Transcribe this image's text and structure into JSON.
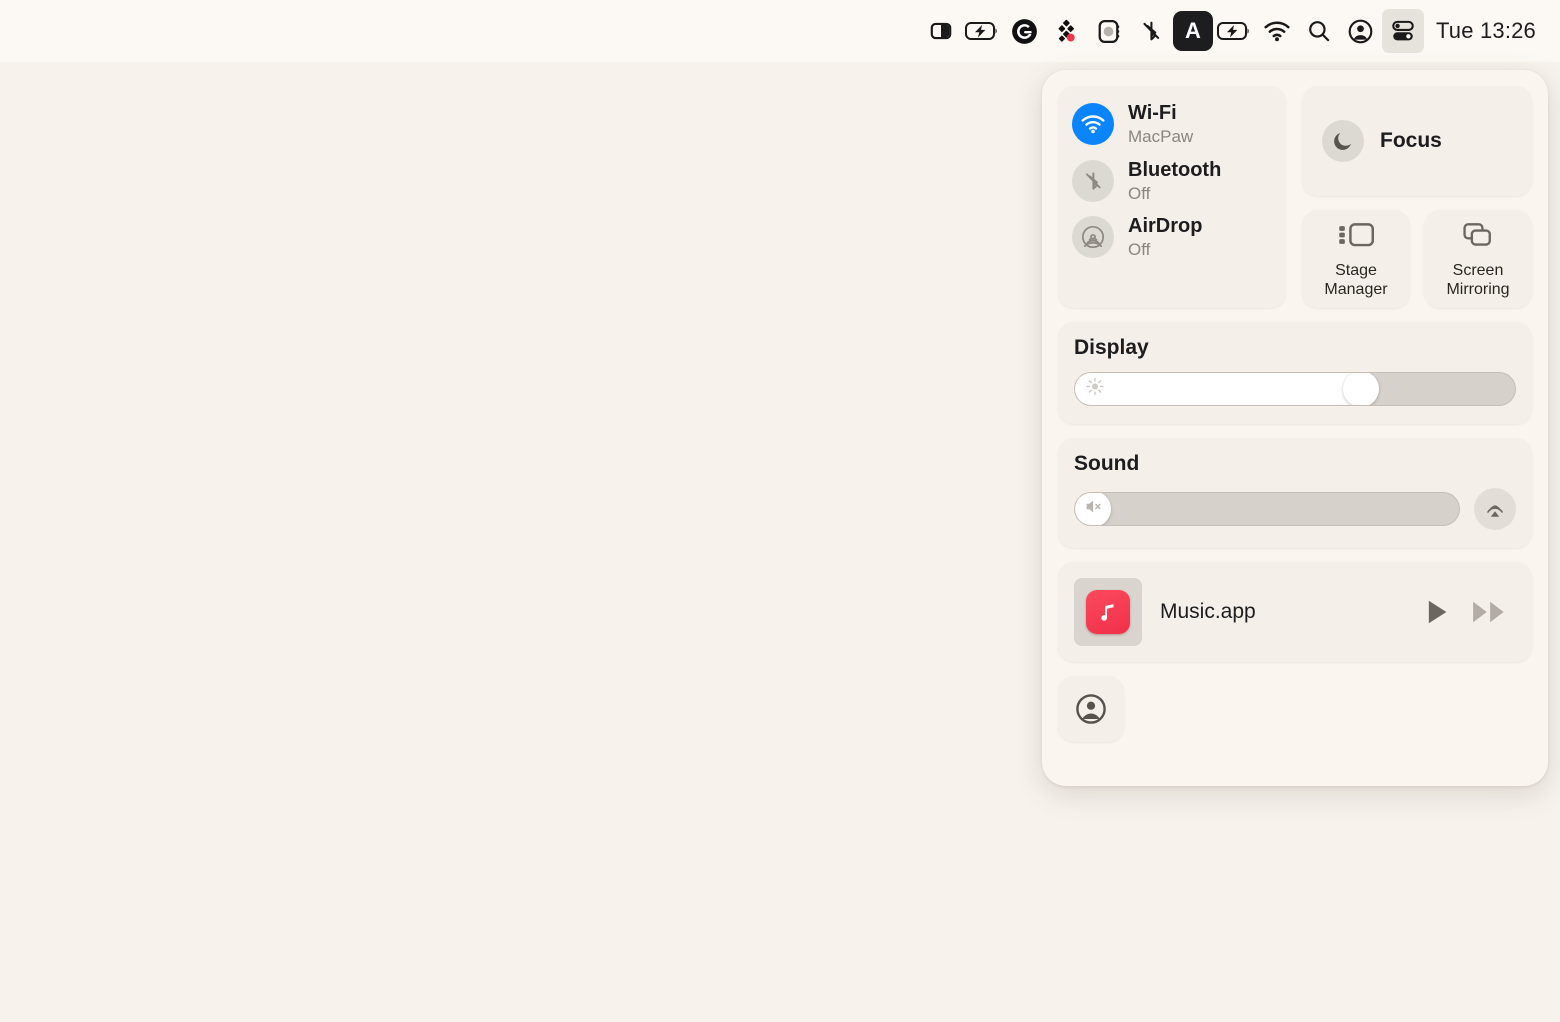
{
  "menubar": {
    "icons": [
      {
        "name": "split-view-icon",
        "label": "Split View"
      },
      {
        "name": "battery-charging-icon",
        "label": "Battery Charging"
      },
      {
        "name": "grammarly-icon",
        "label": "Grammarly"
      },
      {
        "name": "dropover-icon",
        "label": "Dropover"
      },
      {
        "name": "camera-shutter-icon",
        "label": "Camera"
      },
      {
        "name": "bluetooth-off-icon",
        "label": "Bluetooth Off"
      },
      {
        "name": "input-source-icon",
        "label": "A"
      },
      {
        "name": "battery-charging-icon",
        "label": "Battery Charging"
      },
      {
        "name": "wifi-icon",
        "label": "Wi-Fi"
      },
      {
        "name": "spotlight-search-icon",
        "label": "Spotlight Search"
      },
      {
        "name": "user-account-icon",
        "label": "Account"
      },
      {
        "name": "control-center-icon",
        "label": "Control Center"
      }
    ],
    "input_source_letter": "A",
    "clock": "Tue 13:26"
  },
  "control_center": {
    "connectivity": [
      {
        "title": "Wi-Fi",
        "status": "MacPaw",
        "state": "on",
        "icon": "wifi-icon"
      },
      {
        "title": "Bluetooth",
        "status": "Off",
        "state": "off",
        "icon": "bluetooth-off-icon"
      },
      {
        "title": "AirDrop",
        "status": "Off",
        "state": "off",
        "icon": "airdrop-icon"
      }
    ],
    "focus": {
      "label": "Focus",
      "icon": "moon-icon"
    },
    "tiles": [
      {
        "label": "Stage\nManager",
        "line1": "Stage",
        "line2": "Manager",
        "icon": "stage-manager-icon"
      },
      {
        "label": "Screen\nMirroring",
        "line1": "Screen",
        "line2": "Mirroring",
        "icon": "screen-mirroring-icon"
      }
    ],
    "display": {
      "title": "Display",
      "value": 65,
      "icon": "brightness-icon"
    },
    "sound": {
      "title": "Sound",
      "value": 0,
      "icon": "speaker-mute-icon",
      "output_icon": "airplay-audio-icon"
    },
    "now_playing": {
      "app": "Music.app",
      "app_icon": "music-note-icon",
      "play_label": "Play",
      "forward_label": "Fast Forward"
    },
    "user_button": {
      "icon": "user-account-icon",
      "label": "Fast User Switching"
    }
  },
  "colors": {
    "accent_blue": "#0a84ff",
    "desktop": "#f7f2ec",
    "menubar": "#fcf9f4",
    "panel": "#faf5ef",
    "module": "#f4efe9",
    "music_red": "#f12f4a"
  }
}
